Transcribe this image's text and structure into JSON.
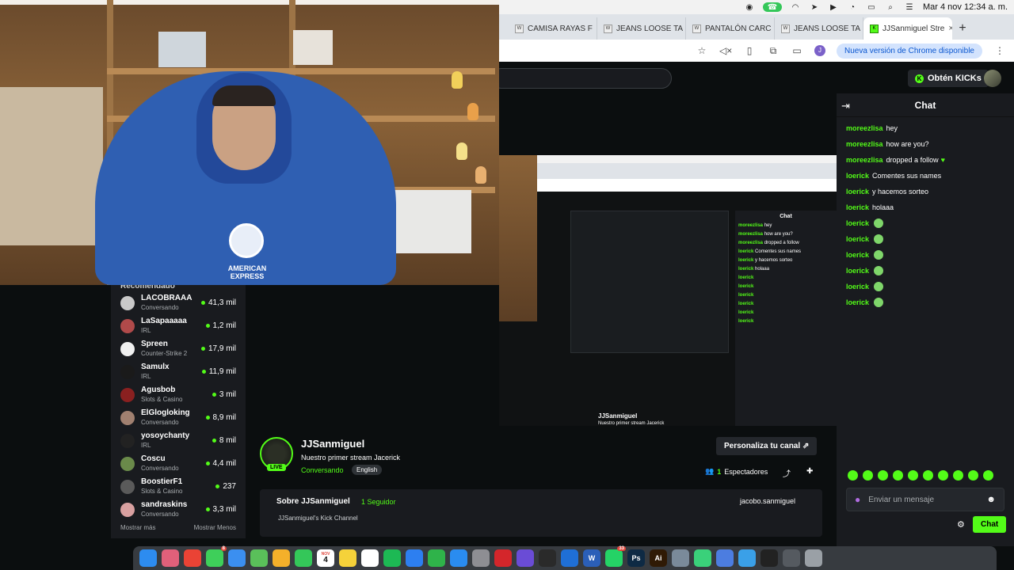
{
  "menubar": {
    "clock": "Mar 4 nov 12:34 a. m.",
    "icons": [
      "adobe-icon",
      "phone-icon",
      "wifi-icon",
      "pointer-icon",
      "play-icon",
      "timer-icon",
      "battery-icon",
      "search-icon",
      "control-center-icon"
    ]
  },
  "browser": {
    "tabs": [
      {
        "label": "CAMISA RAYAS F",
        "icon": "store-icon",
        "active": false
      },
      {
        "label": "JEANS LOOSE TA",
        "icon": "store-icon",
        "active": false
      },
      {
        "label": "PANTALÓN CARC",
        "icon": "store-icon",
        "active": false
      },
      {
        "label": "JEANS LOOSE TA",
        "icon": "store-icon",
        "active": false
      },
      {
        "label": "JJSanmiguel Stre",
        "icon": "kick-icon",
        "active": true
      }
    ],
    "update_button": "Nueva versión de Chrome disponible"
  },
  "kick": {
    "get_kicks": "Obtén KICKs",
    "sidebar": {
      "heading": "Recomendado",
      "show_more": "Mostrar más",
      "show_less": "Mostrar Menos",
      "items": [
        {
          "name": "LACOBRAAA",
          "category": "Conversando",
          "viewers": "41,3 mil",
          "color": "#c9c9c9"
        },
        {
          "name": "LaSapaaaaa",
          "category": "IRL",
          "viewers": "1,2 mil",
          "color": "#b04a4a"
        },
        {
          "name": "Spreen",
          "category": "Counter-Strike 2",
          "viewers": "17,9 mil",
          "color": "#f0f0f0"
        },
        {
          "name": "Samulx",
          "category": "IRL",
          "viewers": "11,9 mil",
          "color": "#1a1a1a"
        },
        {
          "name": "Agusbob",
          "category": "Slots & Casino",
          "viewers": "3 mil",
          "color": "#8a2020"
        },
        {
          "name": "ElGlogloking",
          "category": "Conversando",
          "viewers": "8,9 mil",
          "color": "#a08070"
        },
        {
          "name": "yosoychanty",
          "category": "IRL",
          "viewers": "8 mil",
          "color": "#222222"
        },
        {
          "name": "Coscu",
          "category": "Conversando",
          "viewers": "4,4 mil",
          "color": "#6a8a4a"
        },
        {
          "name": "BoostierF1",
          "category": "Slots & Casino",
          "viewers": "237",
          "color": "#5a5a5a"
        },
        {
          "name": "sandraskins",
          "category": "Conversando",
          "viewers": "3,3 mil",
          "color": "#d8a0a0"
        }
      ]
    },
    "webcam": {
      "shirt_text": "AMERICAN EXPRESS"
    },
    "channel": {
      "name": "JJSanmiguel",
      "stream_title": "Nuestro primer stream Jacerick",
      "category": "Conversando",
      "language": "English",
      "live_label": "LIVE",
      "customize_button": "Personaliza tu canal",
      "viewers_count": "1",
      "viewers_label": "Espectadores",
      "about_title": "Sobre JJSanmiguel",
      "followers": "1 Seguidor",
      "social": "jacobo.sanmiguel",
      "description": "JJSanmiguel's Kick Channel"
    },
    "chat": {
      "title": "Chat",
      "messages": [
        {
          "user": "moreezlisa",
          "text": "hey",
          "emote": ""
        },
        {
          "user": "moreezlisa",
          "text": "how are you?",
          "emote": ""
        },
        {
          "user": "moreezlisa",
          "text": "dropped a follow",
          "emote": "heart"
        },
        {
          "user": "loerick",
          "text": "Comentes sus names",
          "emote": ""
        },
        {
          "user": "loerick",
          "text": "y hacemos sorteo",
          "emote": ""
        },
        {
          "user": "loerick",
          "text": "holaaa",
          "emote": ""
        },
        {
          "user": "loerick",
          "text": "",
          "emote": "kick-emote"
        },
        {
          "user": "loerick",
          "text": "",
          "emote": "kick-emote"
        },
        {
          "user": "loerick",
          "text": "",
          "emote": "kick-emote"
        },
        {
          "user": "loerick",
          "text": "",
          "emote": "kick-emote"
        },
        {
          "user": "loerick",
          "text": "",
          "emote": "kick-emote"
        },
        {
          "user": "loerick",
          "text": "",
          "emote": "kick-emote"
        }
      ],
      "input_placeholder": "Enviar un mensaje",
      "send_button": "Chat"
    },
    "nested": {
      "chat_title": "Chat",
      "channel_name": "JJSanmiguel",
      "stream_title": "Nuestro primer stream Jacerick"
    }
  },
  "dock": {
    "apps": [
      {
        "name": "finder-icon",
        "label": "",
        "color": "#2d8cf0"
      },
      {
        "name": "launchpad-icon",
        "label": "",
        "color": "#e0607a"
      },
      {
        "name": "chrome-icon",
        "label": "",
        "color": "#ea4335"
      },
      {
        "name": "messages-icon",
        "label": "",
        "color": "#3ecf5a",
        "badge": "8"
      },
      {
        "name": "mail-icon",
        "label": "",
        "color": "#3b8ff0"
      },
      {
        "name": "maps-icon",
        "label": "",
        "color": "#5ac05a"
      },
      {
        "name": "photos-icon",
        "label": "",
        "color": "#f4b02a"
      },
      {
        "name": "facetime-icon",
        "label": "",
        "color": "#34c759"
      },
      {
        "name": "calendar-icon",
        "label": "4",
        "month": "NOV",
        "color": "#ffffff"
      },
      {
        "name": "notes-icon",
        "label": "",
        "color": "#f5d23a"
      },
      {
        "name": "freeform-icon",
        "label": "",
        "color": "#ffffff"
      },
      {
        "name": "spotify-icon",
        "label": "",
        "color": "#1db954"
      },
      {
        "name": "keynote-icon",
        "label": "",
        "color": "#2d7ff0"
      },
      {
        "name": "numbers-icon",
        "label": "",
        "color": "#2fb34a"
      },
      {
        "name": "appstore-icon",
        "label": "",
        "color": "#2a8cf0"
      },
      {
        "name": "settings-icon",
        "label": "",
        "color": "#8e8e93"
      },
      {
        "name": "acrobat-icon",
        "label": "",
        "color": "#d4262b"
      },
      {
        "name": "copilot-icon",
        "label": "",
        "color": "#6a4cd6"
      },
      {
        "name": "obs-icon",
        "label": "",
        "color": "#2a2a2a"
      },
      {
        "name": "xcode-icon",
        "label": "",
        "color": "#1f6fd6"
      },
      {
        "name": "word-icon",
        "label": "W",
        "color": "#2b5fb8"
      },
      {
        "name": "whatsapp-icon",
        "label": "",
        "color": "#25d366",
        "badge": "33"
      },
      {
        "name": "photoshop-icon",
        "label": "Ps",
        "color": "#0e2a44"
      },
      {
        "name": "illustrator-icon",
        "label": "Ai",
        "color": "#2f1a05"
      },
      {
        "name": "preview-icon",
        "label": "",
        "color": "#7a8a9a"
      },
      {
        "name": "recorder-icon",
        "label": "",
        "color": "#3ad17a"
      },
      {
        "name": "screen-icon",
        "label": "",
        "color": "#4c7de0"
      },
      {
        "name": "weather-icon",
        "label": "",
        "color": "#3aa0e8"
      },
      {
        "name": "terminal-icon",
        "label": "",
        "color": "#222222"
      },
      {
        "name": "downloads-icon",
        "label": "",
        "color": "#555a60"
      },
      {
        "name": "trash-icon",
        "label": "",
        "color": "#9aa0a6"
      }
    ]
  }
}
